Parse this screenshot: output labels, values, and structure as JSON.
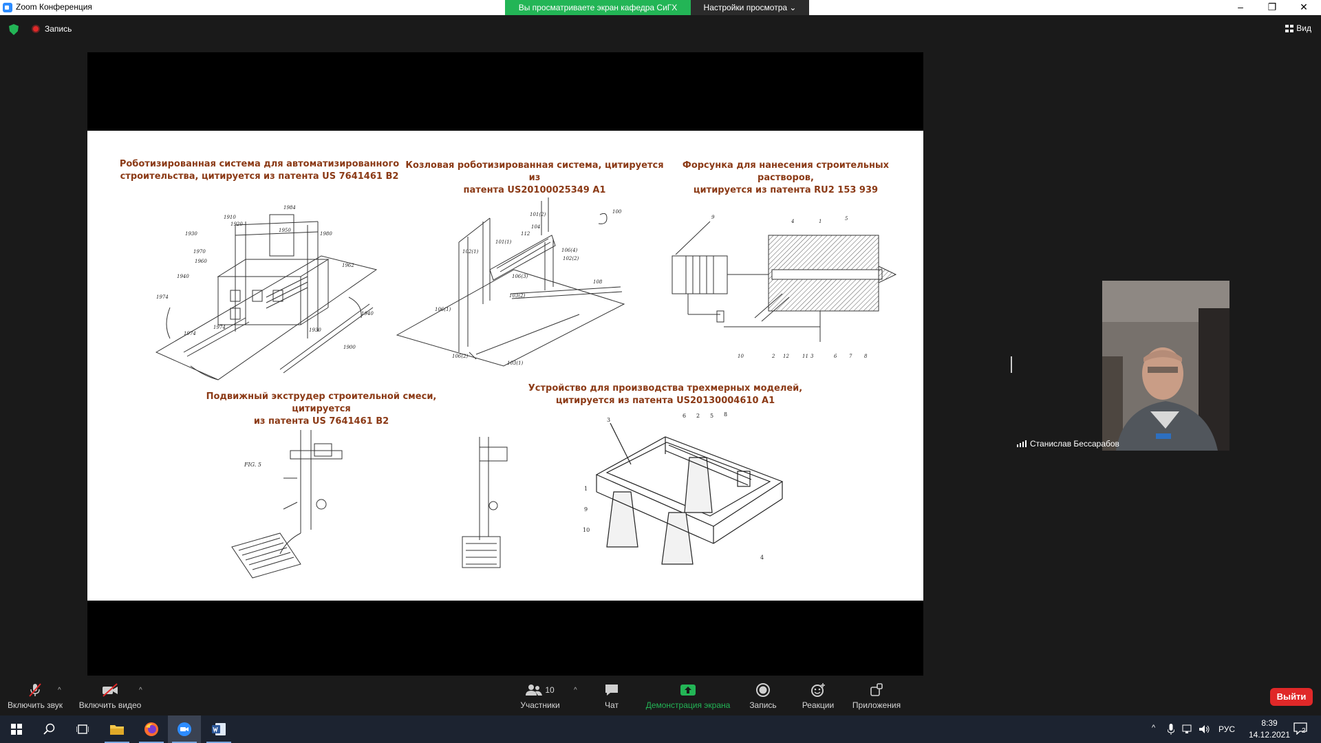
{
  "window": {
    "title": "Zoom Конференция",
    "share_banner": "Вы просматриваете экран кафедра СиГХ",
    "view_options": "Настройки просмотра ⌄",
    "controls": [
      "–",
      "❐",
      "✕"
    ]
  },
  "topbar": {
    "recording": "Запись",
    "view_button": "Вид"
  },
  "slide": {
    "captions": [
      "Роботизированная система для автоматизированного строительства, цитируется из патента US 7641461 B2",
      "Козловая роботизированная система, цитируется из патента US20100025349 A1",
      "Форсунка для нанесения строительных растворов, цитируется из патента RU2 153 939",
      "Подвижный экструдер строительной смеси, цитируется из патента US 7641461 B2",
      "Устройство для производства трехмерных моделей, цитируется из патента US20130004610 A1"
    ],
    "caption_lines": [
      [
        "Роботизированная система для автоматизированного",
        "строительства, цитируется из патента US 7641461 B2"
      ],
      [
        "Козловая роботизированная система, цитируется из",
        "патента US20100025349 A1"
      ],
      [
        "Форсунка для нанесения строительных растворов,",
        "цитируется из патента RU2 153 939"
      ],
      [
        "Подвижный экструдер строительной смеси, цитируется",
        "из патента US 7641461 B2"
      ],
      [
        "Устройство для производства трехмерных моделей,",
        "цитируется из патента US20130004610 A1"
      ]
    ],
    "fig_labels": {
      "fig1": [
        "1984",
        "1910",
        "1920",
        "1950",
        "1980",
        "1930",
        "1970",
        "1960",
        "1962",
        "1940",
        "1974",
        "1974",
        "1930",
        "1940",
        "1900",
        "1974"
      ],
      "fig2": [
        "100",
        "101(2)",
        "104",
        "112",
        "102(1)",
        "101(1)",
        "106(4)",
        "102(2)",
        "106(3)",
        "108",
        "106(1)",
        "103(2)",
        "106(2)",
        "103(1)"
      ],
      "fig3": [
        "9",
        "4",
        "1",
        "5",
        "10",
        "2",
        "12",
        "11",
        "3",
        "6",
        "7",
        "8"
      ],
      "fig4": [
        "FIG. 5"
      ],
      "fig5": [
        "3",
        "6",
        "2",
        "5",
        "8",
        "1",
        "9",
        "10",
        "4"
      ]
    }
  },
  "participant": {
    "name": "Станислав Бессарабов"
  },
  "toolbar": {
    "mute": "Включить звук",
    "video": "Включить видео",
    "participants": "Участники",
    "participants_count": "10",
    "chat": "Чат",
    "share": "Демонстрация экрана",
    "record": "Запись",
    "reactions": "Реакции",
    "apps": "Приложения",
    "leave": "Выйти"
  },
  "taskbar": {
    "lang": "РУС",
    "time": "8:39",
    "date": "14.12.2021",
    "notifications": "2"
  },
  "colors": {
    "caption": "#8b3a16",
    "share_green": "#23b556",
    "leave_red": "#e02828",
    "background": "#1a1a1a"
  }
}
